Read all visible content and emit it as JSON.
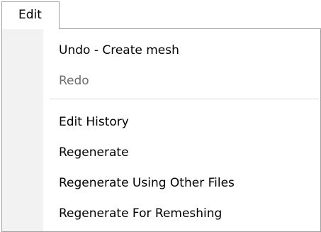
{
  "menubar": {
    "title": "Edit"
  },
  "menu": {
    "items": [
      {
        "label": "Undo - Create mesh",
        "enabled": true
      },
      {
        "label": "Redo",
        "enabled": false
      },
      {
        "label": "Edit History",
        "enabled": true
      },
      {
        "label": "Regenerate",
        "enabled": true
      },
      {
        "label": "Regenerate Using Other Files",
        "enabled": true
      },
      {
        "label": "Regenerate For Remeshing",
        "enabled": true
      }
    ]
  }
}
